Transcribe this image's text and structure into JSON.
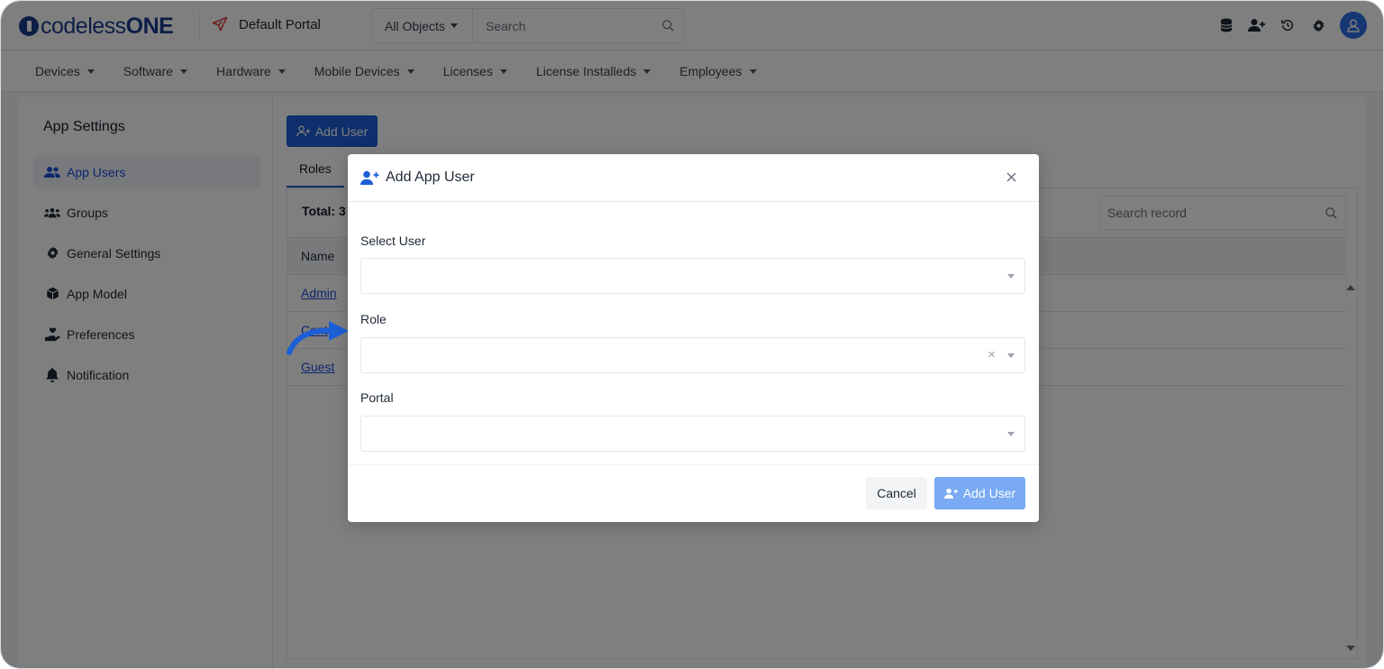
{
  "header": {
    "brand_light": "codeless",
    "brand_bold": "ONE",
    "portal_name": "Default Portal",
    "object_select": "All Objects",
    "search_placeholder": "Search"
  },
  "nav": {
    "items": [
      {
        "label": "Devices"
      },
      {
        "label": "Software"
      },
      {
        "label": "Hardware"
      },
      {
        "label": "Mobile Devices"
      },
      {
        "label": "Licenses"
      },
      {
        "label": "License Installeds"
      },
      {
        "label": "Employees"
      }
    ]
  },
  "sidebar": {
    "title": "App Settings",
    "items": [
      {
        "label": "App Users",
        "icon": "users-icon",
        "active": true
      },
      {
        "label": "Groups",
        "icon": "groups-icon"
      },
      {
        "label": "General Settings",
        "icon": "gear-icon"
      },
      {
        "label": "App Model",
        "icon": "cube-icon"
      },
      {
        "label": "Preferences",
        "icon": "hand-heart-icon"
      },
      {
        "label": "Notification",
        "icon": "bell-icon"
      }
    ]
  },
  "content": {
    "add_user_label": "Add User",
    "tab_roles": "Roles",
    "total_label": "Total: 3",
    "search_record_placeholder": "Search record",
    "column_name": "Name",
    "rows": [
      {
        "name": "Admin"
      },
      {
        "name": "Cont"
      },
      {
        "name": "Guest"
      }
    ]
  },
  "modal": {
    "title": "Add App User",
    "select_user_label": "Select User",
    "role_label": "Role",
    "portal_label": "Portal",
    "cancel_label": "Cancel",
    "add_user_label": "Add User"
  },
  "colors": {
    "primary": "#1d5fd6",
    "primary_disabled": "#79aaf3",
    "brand": "#1b3c8c",
    "portal_icon": "#d63c3c"
  }
}
